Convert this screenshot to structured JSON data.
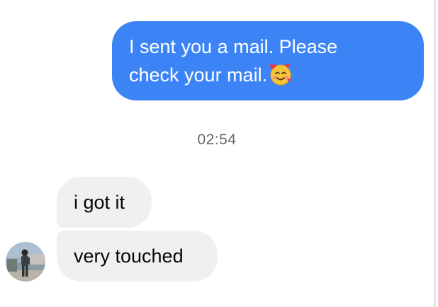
{
  "conversation": {
    "messages": [
      {
        "direction": "outgoing",
        "line1": "I sent you a mail. Please",
        "line2": "check your mail.",
        "emoji": "smiling-face-with-hearts-icon"
      },
      {
        "direction": "incoming",
        "text": "i got it"
      },
      {
        "direction": "incoming",
        "text": "very touched"
      }
    ],
    "timestamp": "02:54",
    "contact_avatar": "person-at-waterfront-photo"
  },
  "colors": {
    "outgoing_bubble": "#3c84f5",
    "incoming_bubble": "#f0f0f0",
    "timestamp_text": "#65676b"
  }
}
